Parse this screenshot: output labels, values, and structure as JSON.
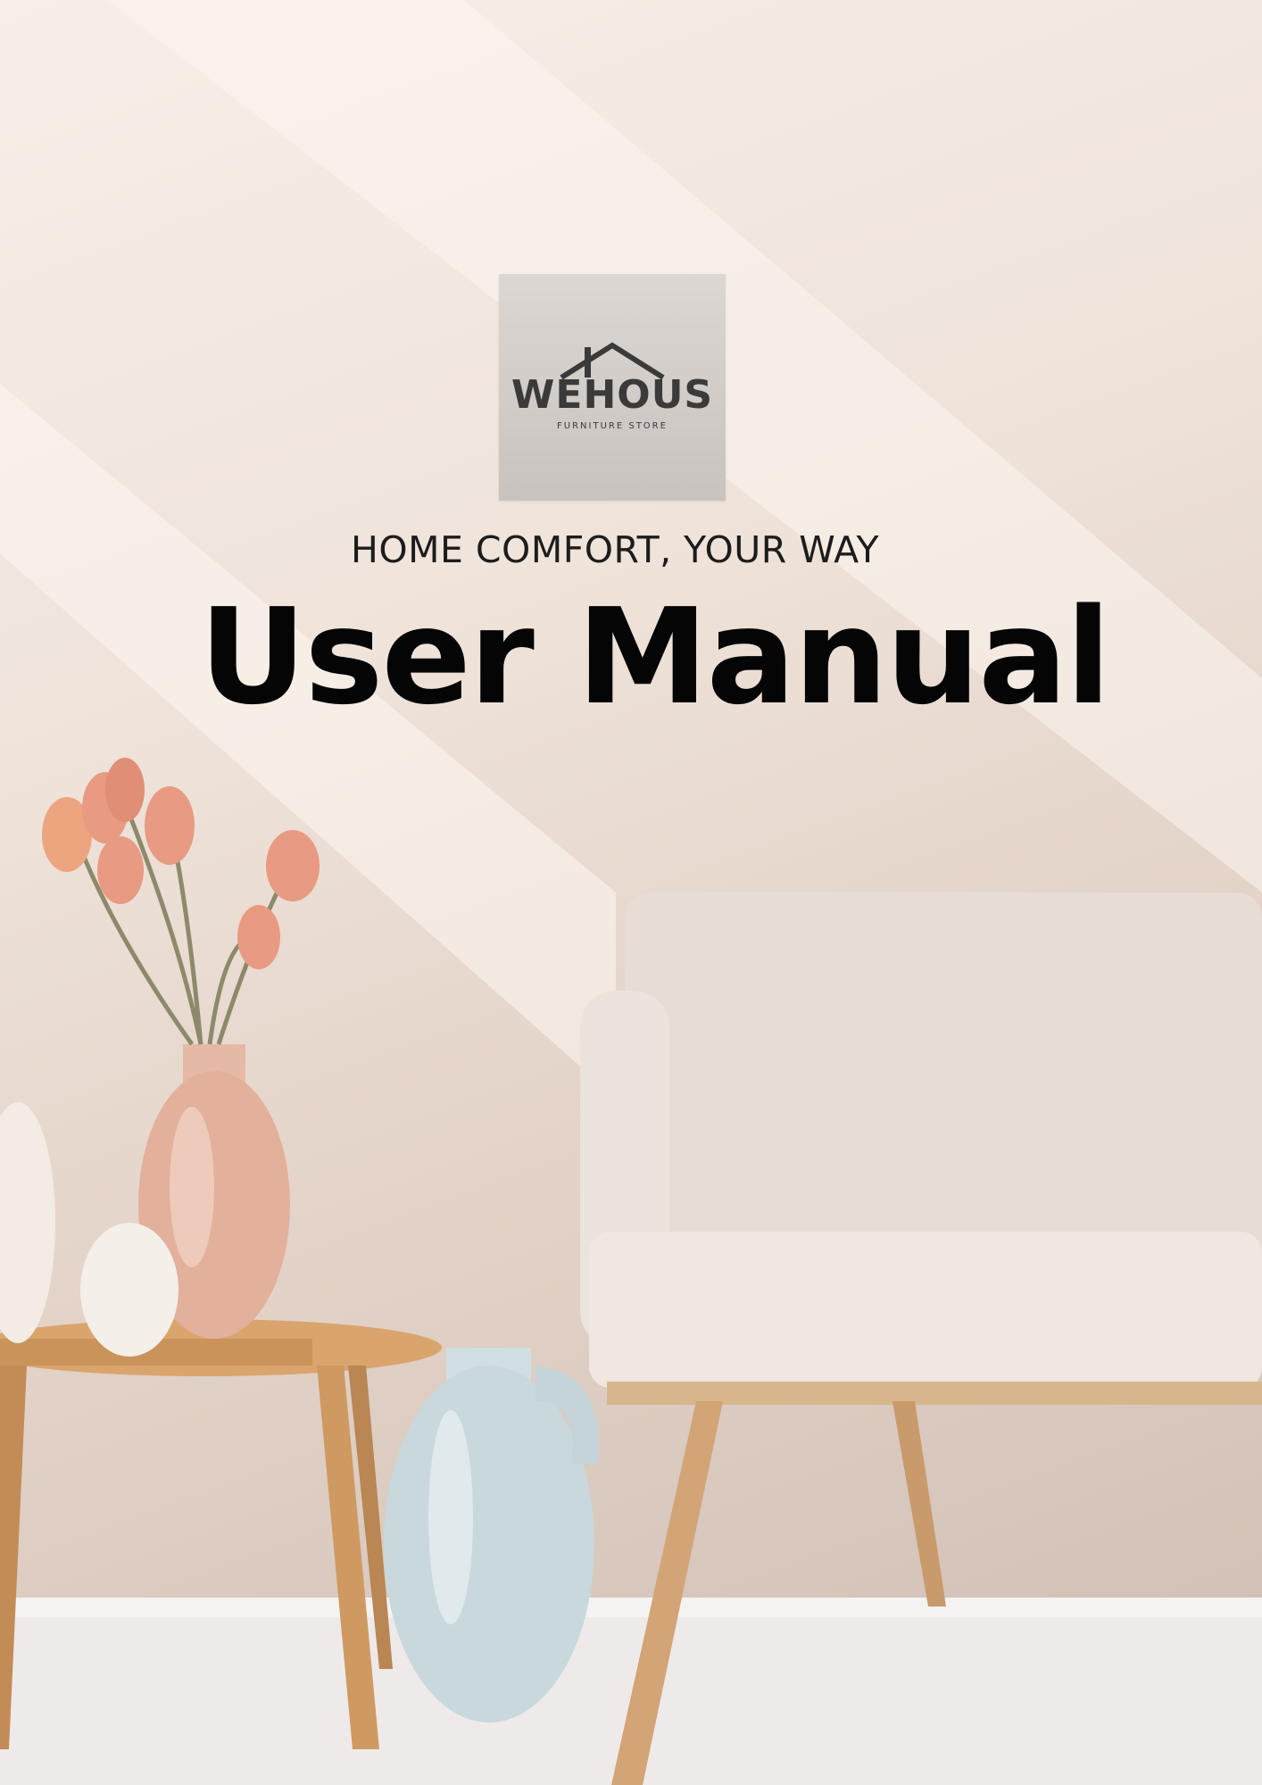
{
  "brand": {
    "name": "WEHOUS",
    "subtitle": "FURNITURE STORE",
    "color": "#3a3a3a"
  },
  "cover": {
    "tagline": "HOME COMFORT, YOUR WAY",
    "title": "User Manual"
  },
  "photo": {
    "subject": "living-room-scene",
    "colors": {
      "wall": "#efe3da",
      "sofa": "#e6dad2",
      "wood": "#c9935a",
      "vase_pink": "#e3b29c",
      "vase_blue": "#c9d8dc",
      "tulips": "#e89a82"
    }
  }
}
